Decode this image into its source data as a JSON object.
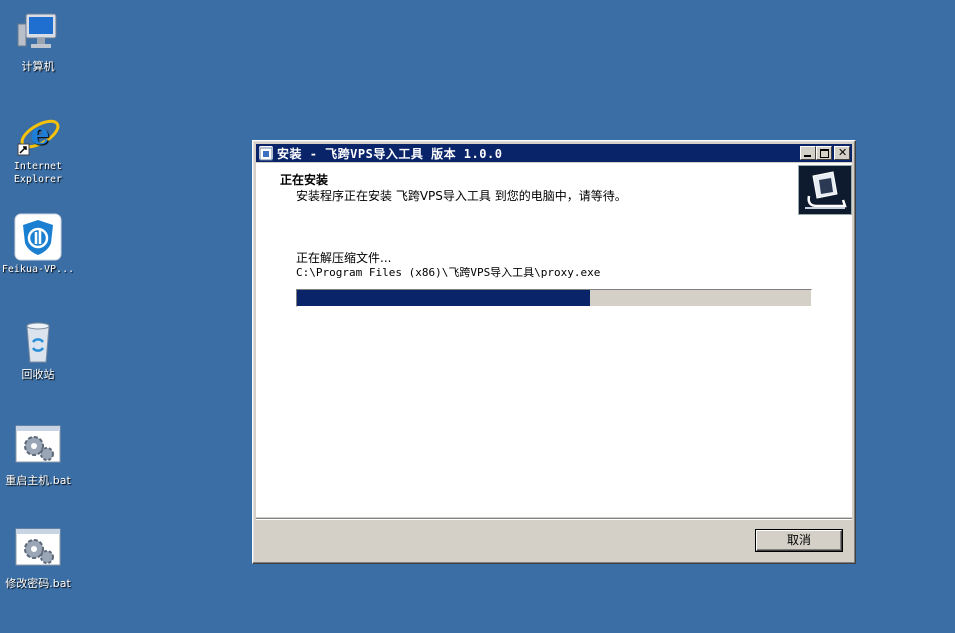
{
  "desktop": {
    "icons": [
      {
        "label": "计算机",
        "icon": "computer-icon"
      },
      {
        "label": "Internet\nExplorer",
        "icon": "internet-explorer-icon"
      },
      {
        "label": "Feikua-VP...",
        "icon": "feikua-vps-icon"
      },
      {
        "label": "回收站",
        "icon": "recycle-bin-icon"
      },
      {
        "label": "重启主机.bat",
        "icon": "batch-file-icon"
      },
      {
        "label": "修改密码.bat",
        "icon": "batch-file-icon"
      }
    ]
  },
  "window": {
    "title": "安装 - 飞跨VPS导入工具 版本 1.0.0",
    "heading": "正在安装",
    "subheading": "安装程序正在安装 飞跨VPS导入工具 到您的电脑中，请等待。",
    "status": "正在解压缩文件...",
    "path": "C:\\Program Files (x86)\\飞跨VPS导入工具\\proxy.exe",
    "progress_percent": 57,
    "cancel_label": "取消",
    "colors": {
      "titlebar": "#0a246a",
      "progress": "#0a246a",
      "desktop": "#3a6ea5"
    }
  }
}
